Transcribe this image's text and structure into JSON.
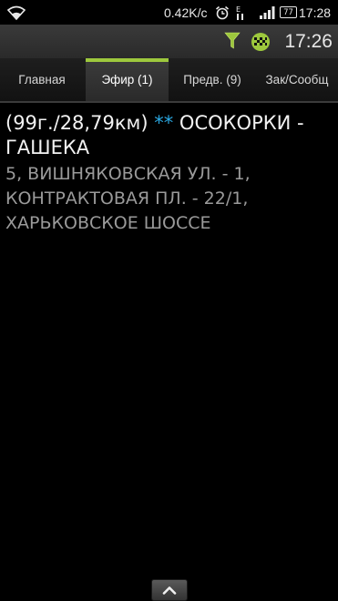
{
  "status_bar": {
    "speed": "0.42K/c",
    "battery_level": "77",
    "time": "17:28",
    "icons": [
      "wifi-icon",
      "alarm-icon",
      "network-e-icon",
      "signal-icon",
      "battery-icon"
    ]
  },
  "header": {
    "time": "17:26",
    "icons": [
      "filter-icon",
      "taxi-icon"
    ],
    "accent_color": "#9dc83d"
  },
  "tabs": [
    {
      "label": "Главная",
      "active": false
    },
    {
      "label": "Эфир (1)",
      "active": true
    },
    {
      "label": "Предв. (9)",
      "active": false
    },
    {
      "label": "Зак/Сообщ",
      "active": false
    }
  ],
  "order": {
    "prefix": "(99г./28,79км)",
    "stars": "**",
    "title": "ОСОКОРКИ - ГАШЕКА",
    "route": "5, ВИШНЯКОВСКАЯ УЛ. - 1, КОНТРАКТОВАЯ ПЛ. - 22/1, ХАРЬКОВСКОЕ ШОССЕ"
  },
  "bottom": {
    "expand_icon": "chevron-up-icon"
  }
}
